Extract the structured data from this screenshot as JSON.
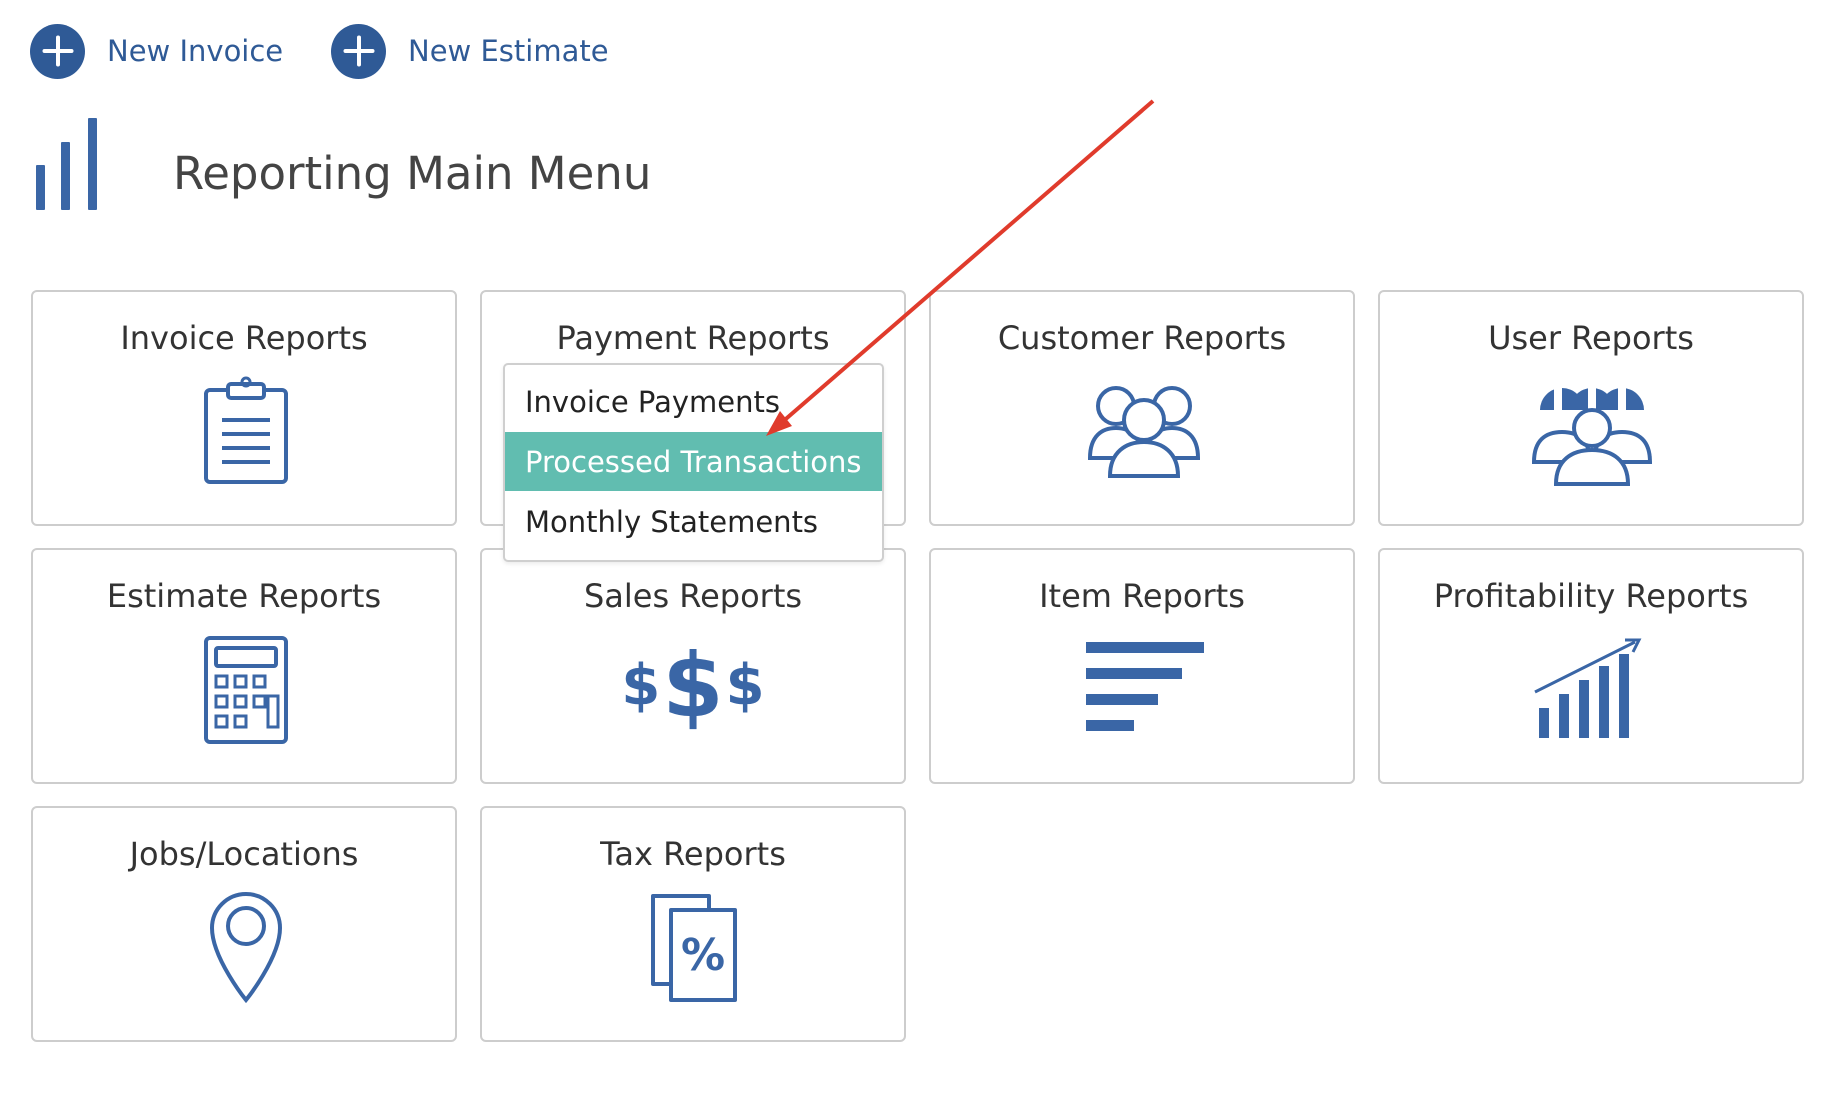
{
  "colors": {
    "brand_blue": "#2f5a96",
    "icon_blue": "#3a66a6",
    "highlight_teal": "#61bdb0",
    "annotation_red": "#e03b2c",
    "card_border": "#cdcdcd"
  },
  "top_actions": [
    {
      "label": "New Invoice",
      "icon": "plus-circle-icon"
    },
    {
      "label": "New Estimate",
      "icon": "plus-circle-icon"
    }
  ],
  "header": {
    "title": "Reporting Main Menu",
    "icon": "bar-chart-icon"
  },
  "cards": [
    {
      "title": "Invoice Reports",
      "icon": "clipboard-icon"
    },
    {
      "title": "Payment Reports",
      "icon": "payment-icon"
    },
    {
      "title": "Customer Reports",
      "icon": "customers-group-icon"
    },
    {
      "title": "User Reports",
      "icon": "users-hardhat-icon"
    },
    {
      "title": "Estimate Reports",
      "icon": "calculator-icon"
    },
    {
      "title": "Sales Reports",
      "icon": "dollar-signs-icon"
    },
    {
      "title": "Item Reports",
      "icon": "list-lines-icon"
    },
    {
      "title": "Profitability Reports",
      "icon": "growth-chart-icon"
    },
    {
      "title": "Jobs/Locations",
      "icon": "location-pin-icon"
    },
    {
      "title": "Tax Reports",
      "icon": "tax-document-icon"
    }
  ],
  "payment_dropdown": {
    "items": [
      "Invoice Payments",
      "Processed Transactions",
      "Monthly Statements"
    ],
    "highlighted": "Processed Transactions"
  },
  "sales_icon_glyphs": [
    "$",
    "$",
    "$"
  ],
  "tax_icon_glyph": "%"
}
